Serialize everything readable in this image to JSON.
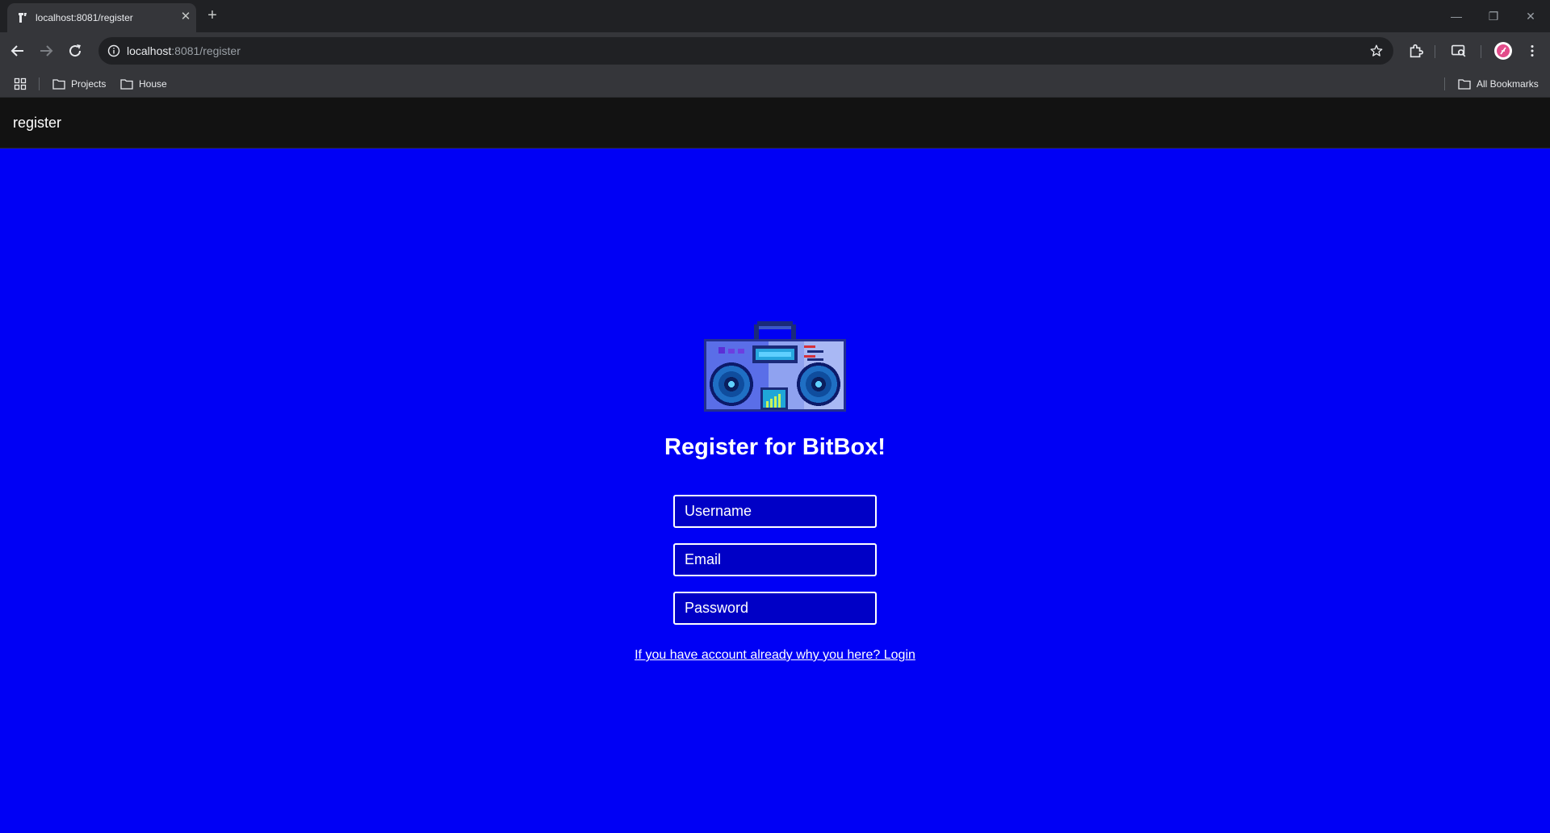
{
  "browser": {
    "tab_title": "localhost:8081/register",
    "url_host": "localhost",
    "url_path": ":8081/register",
    "bookmarks": [
      {
        "label": "Projects"
      },
      {
        "label": "House"
      }
    ],
    "all_bookmarks_label": "All Bookmarks"
  },
  "app": {
    "appbar_title": "register",
    "heading": "Register for BitBox!",
    "fields": {
      "username_placeholder": "Username",
      "email_placeholder": "Email",
      "password_placeholder": "Password",
      "username_value": "",
      "email_value": "",
      "password_value": ""
    },
    "login_link": "If you have account already why you here? Login"
  },
  "colors": {
    "page_background": "#0000f5",
    "appbar_background": "#121212",
    "field_background": "#0000c6",
    "text": "#ffffff"
  },
  "icons": [
    "tab-favicon",
    "close-icon",
    "plus-icon",
    "back-arrow-icon",
    "forward-arrow-icon",
    "reload-icon",
    "info-icon",
    "star-icon",
    "extensions-icon",
    "cast-search-icon",
    "profile-avatar",
    "kebab-menu-icon",
    "apps-grid-icon",
    "folder-icon",
    "boombox-logo"
  ]
}
